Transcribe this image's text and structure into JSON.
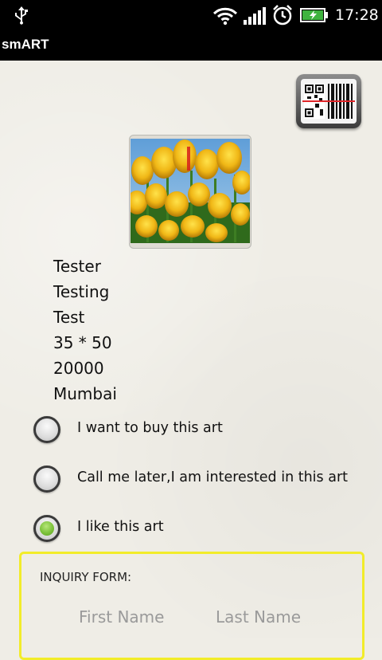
{
  "status_bar": {
    "time": "17:28"
  },
  "app": {
    "title": "smART"
  },
  "artwork": {
    "image_subject": "yellow tulips",
    "details": [
      "Tester",
      "Testing",
      "Test",
      "35 * 50",
      "20000",
      "Mumbai"
    ]
  },
  "options": [
    {
      "label": "I want to buy this art",
      "checked": false
    },
    {
      "label": "Call me later,I am interested in this art",
      "checked": false
    },
    {
      "label": "I like this art",
      "checked": true
    }
  ],
  "inquiry_form": {
    "heading": "INQUIRY FORM:",
    "first_name_placeholder": "First Name",
    "last_name_placeholder": "Last Name"
  },
  "colors": {
    "form_border": "#f2ec2a",
    "radio_checked": "#7cc23a",
    "bars": "#000000"
  },
  "icons": [
    "usb-icon",
    "wifi-icon",
    "signal-icon",
    "alarm-icon",
    "battery-icon",
    "qr-barcode-icon"
  ]
}
